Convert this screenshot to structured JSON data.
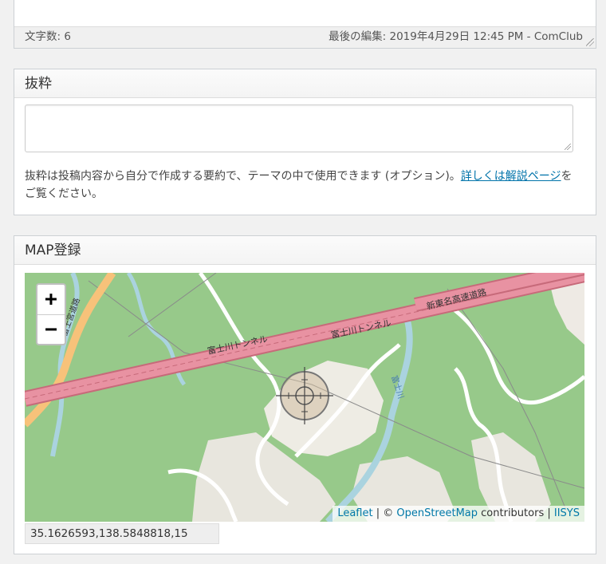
{
  "editor": {
    "word_count": "文字数: 6",
    "last_edit": "最後の編集: 2019年4月29日 12:45 PM - ComClub"
  },
  "excerpt": {
    "title": "抜粋",
    "textarea_value": "",
    "help_prefix": "抜粋は投稿内容から自分で作成する要約で、テーマの中で使用できます (オプション)。",
    "help_link": "詳しくは解説ページ",
    "help_suffix": "をご覧ください。"
  },
  "map": {
    "title": "MAP登録",
    "zoom_in": "+",
    "zoom_out": "−",
    "labels": {
      "tunnel_1": "富士川トンネル",
      "tunnel_2": "富士川トンネル",
      "expressway": "新東名高速道路",
      "river": "富士川",
      "road_vertical": "富士宮道路"
    },
    "attribution": {
      "leaflet": "Leaflet",
      "sep1": " | © ",
      "osm": "OpenStreetMap",
      "contributors": " contributors | ",
      "iisys": "IISYS"
    },
    "coordinates": "35.1626593,138.5848818,15"
  },
  "colors": {
    "forest": "#97c98a",
    "motorway": "#e892a2",
    "river": "#aad3df",
    "link": "#0073aa"
  }
}
